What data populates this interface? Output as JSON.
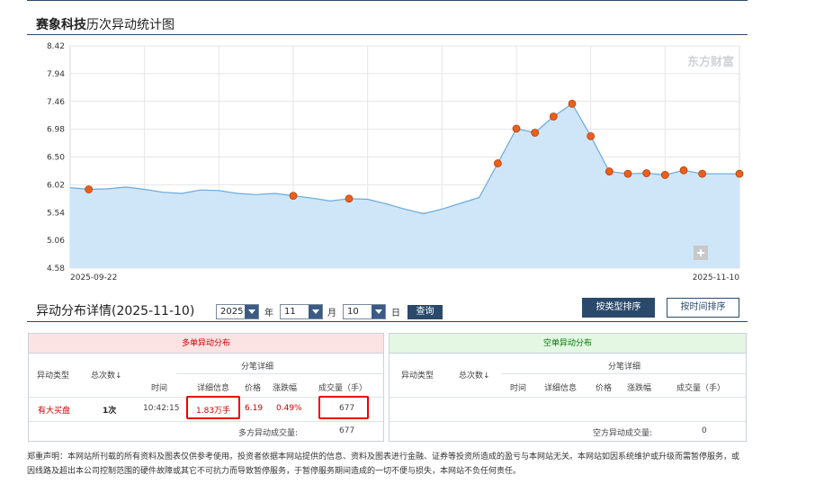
{
  "page": {
    "title_bold": "赛象科技",
    "title_rest": "历次异动统计图"
  },
  "chart_data": {
    "type": "area",
    "watermark": "东方财富",
    "ylim": [
      4.58,
      8.42
    ],
    "yticks": [
      "8.42",
      "7.94",
      "7.46",
      "6.98",
      "6.50",
      "6.02",
      "5.54",
      "5.06",
      "4.58"
    ],
    "x_start_label": "2025-09-22",
    "x_end_label": "2025-11-10",
    "series": [
      {
        "values": [
          5.97,
          5.94,
          5.95,
          5.98,
          5.94,
          5.89,
          5.87,
          5.93,
          5.92,
          5.87,
          5.85,
          5.87,
          5.83,
          5.79,
          5.74,
          5.78,
          5.77,
          5.69,
          5.6,
          5.52,
          5.6,
          5.7,
          5.8,
          6.39,
          6.99,
          6.92,
          7.2,
          7.42,
          6.86,
          6.25,
          6.21,
          6.22,
          6.19,
          6.27,
          6.21,
          6.21,
          6.21
        ]
      }
    ],
    "marked_indices": [
      1,
      12,
      15,
      23,
      24,
      25,
      26,
      27,
      28,
      29,
      30,
      31,
      32,
      33,
      34,
      36
    ],
    "line_color": "#6aa9dc",
    "fill_color": "#cfe6f8",
    "marker_color": "#e8601c"
  },
  "detail": {
    "title": "异动分布详情(2025-11-10)",
    "year": "2025",
    "year_label": "年",
    "month": "11",
    "month_label": "月",
    "day": "10",
    "day_label": "日",
    "query_label": "查询",
    "sort_type_label": "按类型排序",
    "sort_time_label": "按时间排序"
  },
  "long_panel": {
    "title": "多单异动分布",
    "col_type": "异动类型",
    "col_count": "总次数↓",
    "col_detail_group": "分笔详细",
    "col_time": "时间",
    "col_info": "详细信息",
    "col_price": "价格",
    "col_change": "涨跌幅",
    "col_volume": "成交量（手）",
    "row_type": "有大买盘",
    "row_count": "1次",
    "row_time": "10:42:15",
    "row_info": "1.83万手",
    "row_price": "6.19",
    "row_change": "0.49%",
    "row_volume": "677",
    "total_label": "多方异动成交量:",
    "total_value": "677"
  },
  "short_panel": {
    "title": "空单异动分布",
    "col_type": "异动类型",
    "col_count": "总次数↓",
    "col_detail_group": "分笔详细",
    "col_time": "时间",
    "col_info": "详细信息",
    "col_price": "价格",
    "col_change": "涨跌幅",
    "col_volume": "成交量（手）",
    "total_label": "空方异动成交量:",
    "total_value": "0"
  },
  "disclaimer": "郑重声明：本网站所刊载的所有资料及图表仅供参考使用。投资者依据本网站提供的信息、资料及图表进行金融、证券等投资所造成的盈亏与本网站无关。本网站如因系统维护或升级而需暂停服务，或因线路及超出本公司控制范围的硬件故障或其它不可抗力而导致暂停服务，于暂停服务期间造成的一切不便与损失，本网站不负任何责任。"
}
